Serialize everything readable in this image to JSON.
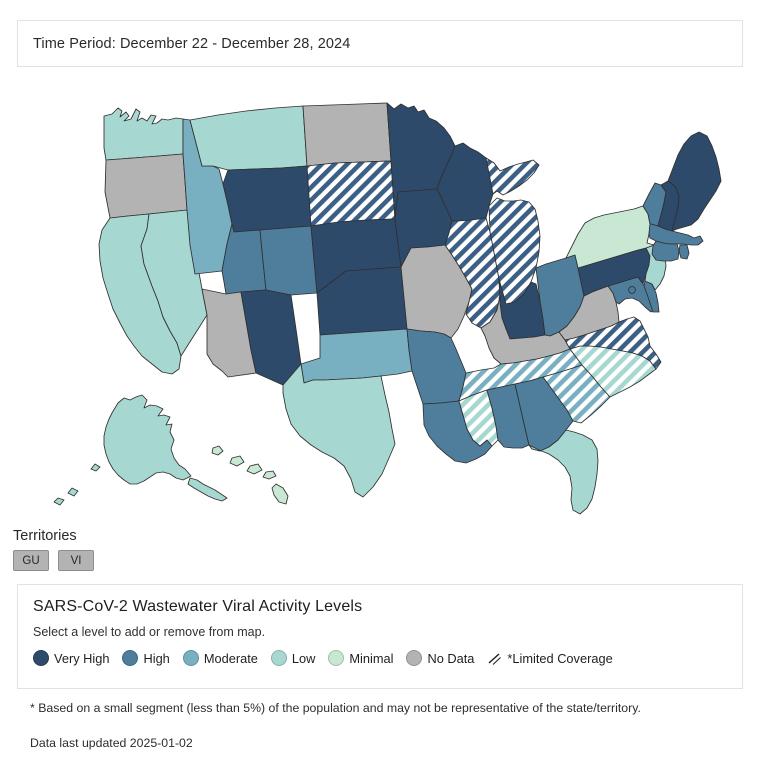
{
  "header": {
    "time_period_label": "Time Period: December 22 - December 28, 2024"
  },
  "territories": {
    "title": "Territories",
    "chips": [
      {
        "code": "GU",
        "level": "No Data"
      },
      {
        "code": "VI",
        "level": "No Data"
      }
    ]
  },
  "legend": {
    "title": "SARS-CoV-2 Wastewater Viral Activity Levels",
    "subtitle": "Select a level to add or remove from map.",
    "items": [
      {
        "label": "Very High",
        "color": "#2e4a6b",
        "swatch": "dot"
      },
      {
        "label": "High",
        "color": "#4e7e9c",
        "swatch": "dot"
      },
      {
        "label": "Moderate",
        "color": "#79b0c1",
        "swatch": "dot"
      },
      {
        "label": "Low",
        "color": "#a6d8d1",
        "swatch": "dot"
      },
      {
        "label": "Minimal",
        "color": "#c8e8d4",
        "swatch": "dot"
      },
      {
        "label": "No Data",
        "color": "#b3b3b3",
        "swatch": "dot"
      },
      {
        "label": "*Limited Coverage",
        "color": "#ffffff",
        "swatch": "hatch"
      }
    ]
  },
  "footnotes": {
    "limited_coverage": "* Based on a small segment (less than 5%) of the population and may not be representative of the state/territory.",
    "last_updated": "Data last updated 2025-01-02"
  },
  "chart_data": {
    "type": "map",
    "title": "SARS-CoV-2 Wastewater Viral Activity Levels",
    "subtitle": "Time Period: December 22 - December 28, 2024",
    "geography": "United States (states and territories)",
    "value_type": "categorical-level",
    "categories": [
      "Very High",
      "High",
      "Moderate",
      "Low",
      "Minimal",
      "No Data"
    ],
    "category_colors": {
      "Very High": "#2e4a6b",
      "High": "#4e7e9c",
      "Moderate": "#79b0c1",
      "Low": "#a6d8d1",
      "Minimal": "#c8e8d4",
      "No Data": "#b3b3b3"
    },
    "hatch_meaning": "*Limited Coverage",
    "legend_position": "bottom",
    "states": [
      {
        "code": "AL",
        "name": "Alabama",
        "level": "High",
        "limited_coverage": false
      },
      {
        "code": "AK",
        "name": "Alaska",
        "level": "Low",
        "limited_coverage": false
      },
      {
        "code": "AZ",
        "name": "Arizona",
        "level": "No Data",
        "limited_coverage": false
      },
      {
        "code": "AR",
        "name": "Arkansas",
        "level": "High",
        "limited_coverage": false
      },
      {
        "code": "CA",
        "name": "California",
        "level": "Low",
        "limited_coverage": false
      },
      {
        "code": "CO",
        "name": "Colorado",
        "level": "High",
        "limited_coverage": false
      },
      {
        "code": "CT",
        "name": "Connecticut",
        "level": "High",
        "limited_coverage": false
      },
      {
        "code": "DE",
        "name": "Delaware",
        "level": "High",
        "limited_coverage": false
      },
      {
        "code": "DC",
        "name": "District of Columbia",
        "level": "High",
        "limited_coverage": false
      },
      {
        "code": "FL",
        "name": "Florida",
        "level": "Low",
        "limited_coverage": false
      },
      {
        "code": "GA",
        "name": "Georgia",
        "level": "High",
        "limited_coverage": false
      },
      {
        "code": "HI",
        "name": "Hawaii",
        "level": "Minimal",
        "limited_coverage": false
      },
      {
        "code": "ID",
        "name": "Idaho",
        "level": "Moderate",
        "limited_coverage": false
      },
      {
        "code": "IL",
        "name": "Illinois",
        "level": "Very High",
        "limited_coverage": true
      },
      {
        "code": "IN",
        "name": "Indiana",
        "level": "Very High",
        "limited_coverage": false
      },
      {
        "code": "IA",
        "name": "Iowa",
        "level": "Very High",
        "limited_coverage": false
      },
      {
        "code": "KS",
        "name": "Kansas",
        "level": "Very High",
        "limited_coverage": false
      },
      {
        "code": "KY",
        "name": "Kentucky",
        "level": "No Data",
        "limited_coverage": false
      },
      {
        "code": "LA",
        "name": "Louisiana",
        "level": "High",
        "limited_coverage": false
      },
      {
        "code": "ME",
        "name": "Maine",
        "level": "Very High",
        "limited_coverage": false
      },
      {
        "code": "MD",
        "name": "Maryland",
        "level": "High",
        "limited_coverage": false
      },
      {
        "code": "MA",
        "name": "Massachusetts",
        "level": "High",
        "limited_coverage": false
      },
      {
        "code": "MI",
        "name": "Michigan",
        "level": "Very High",
        "limited_coverage": true
      },
      {
        "code": "MN",
        "name": "Minnesota",
        "level": "Very High",
        "limited_coverage": false
      },
      {
        "code": "MS",
        "name": "Mississippi",
        "level": "Low",
        "limited_coverage": true
      },
      {
        "code": "MO",
        "name": "Missouri",
        "level": "No Data",
        "limited_coverage": false
      },
      {
        "code": "MT",
        "name": "Montana",
        "level": "Low",
        "limited_coverage": false
      },
      {
        "code": "NE",
        "name": "Nebraska",
        "level": "Very High",
        "limited_coverage": false
      },
      {
        "code": "NV",
        "name": "Nevada",
        "level": "Low",
        "limited_coverage": false
      },
      {
        "code": "NH",
        "name": "New Hampshire",
        "level": "Very High",
        "limited_coverage": false
      },
      {
        "code": "NJ",
        "name": "New Jersey",
        "level": "Low",
        "limited_coverage": false
      },
      {
        "code": "NM",
        "name": "New Mexico",
        "level": "Very High",
        "limited_coverage": false
      },
      {
        "code": "NY",
        "name": "New York",
        "level": "Minimal",
        "limited_coverage": false
      },
      {
        "code": "NC",
        "name": "North Carolina",
        "level": "Low",
        "limited_coverage": true
      },
      {
        "code": "ND",
        "name": "North Dakota",
        "level": "No Data",
        "limited_coverage": false
      },
      {
        "code": "OH",
        "name": "Ohio",
        "level": "High",
        "limited_coverage": false
      },
      {
        "code": "OK",
        "name": "Oklahoma",
        "level": "Moderate",
        "limited_coverage": false
      },
      {
        "code": "OR",
        "name": "Oregon",
        "level": "No Data",
        "limited_coverage": false
      },
      {
        "code": "PA",
        "name": "Pennsylvania",
        "level": "Very High",
        "limited_coverage": false
      },
      {
        "code": "RI",
        "name": "Rhode Island",
        "level": "High",
        "limited_coverage": false
      },
      {
        "code": "SC",
        "name": "South Carolina",
        "level": "Moderate",
        "limited_coverage": true
      },
      {
        "code": "SD",
        "name": "South Dakota",
        "level": "Very High",
        "limited_coverage": true
      },
      {
        "code": "TN",
        "name": "Tennessee",
        "level": "Moderate",
        "limited_coverage": true
      },
      {
        "code": "TX",
        "name": "Texas",
        "level": "Low",
        "limited_coverage": false
      },
      {
        "code": "UT",
        "name": "Utah",
        "level": "High",
        "limited_coverage": false
      },
      {
        "code": "VT",
        "name": "Vermont",
        "level": "High",
        "limited_coverage": false
      },
      {
        "code": "VA",
        "name": "Virginia",
        "level": "Very High",
        "limited_coverage": true
      },
      {
        "code": "WA",
        "name": "Washington",
        "level": "Low",
        "limited_coverage": false
      },
      {
        "code": "WV",
        "name": "West Virginia",
        "level": "No Data",
        "limited_coverage": false
      },
      {
        "code": "WI",
        "name": "Wisconsin",
        "level": "Very High",
        "limited_coverage": false
      },
      {
        "code": "WY",
        "name": "Wyoming",
        "level": "Very High",
        "limited_coverage": false
      },
      {
        "code": "GU",
        "name": "Guam",
        "level": "No Data",
        "limited_coverage": false
      },
      {
        "code": "VI",
        "name": "U.S. Virgin Islands",
        "level": "No Data",
        "limited_coverage": false
      }
    ]
  }
}
